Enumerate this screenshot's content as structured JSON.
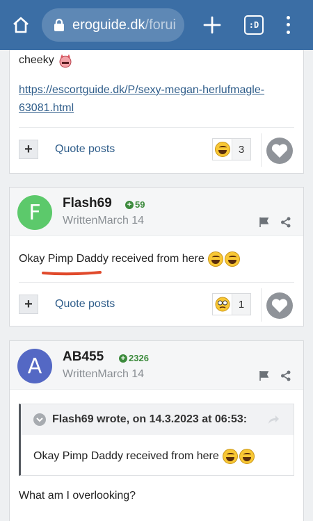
{
  "browser": {
    "url_host": "eroguide.dk",
    "url_path": "/forui",
    "tabs_label": ":D"
  },
  "post1": {
    "text_cheeky": "cheeky",
    "link": "https://escortguide.dk/P/sexy-megan-herlufmagle-63081.html",
    "link_line1": "https://escortguide.dk/P/sexy-megan-herlufmagle-",
    "link_line2": "63081.html",
    "quote_label": "Quote posts",
    "reaction_count": "3"
  },
  "post2": {
    "avatar_letter": "F",
    "avatar_color": "#5cc96b",
    "author": "Flash69",
    "reputation": "59",
    "date": "WrittenMarch 14",
    "text": "Okay Pimp Daddy received from here",
    "quote_label": "Quote posts",
    "reaction_count": "1"
  },
  "post3": {
    "avatar_letter": "A",
    "avatar_color": "#5468c4",
    "author": "AB455",
    "reputation": "2326",
    "date": "WrittenMarch 14",
    "quote_title": "Flash69 wrote, on 14.3.2023 at 06:53:",
    "quote_text": "Okay Pimp Daddy received from here",
    "text": "What am I overlooking?"
  },
  "colors": {
    "browser_bar": "#3b6ea5",
    "link": "#2f5d8a",
    "reputation": "#3d8b3d",
    "underline": "#e04a2c"
  }
}
